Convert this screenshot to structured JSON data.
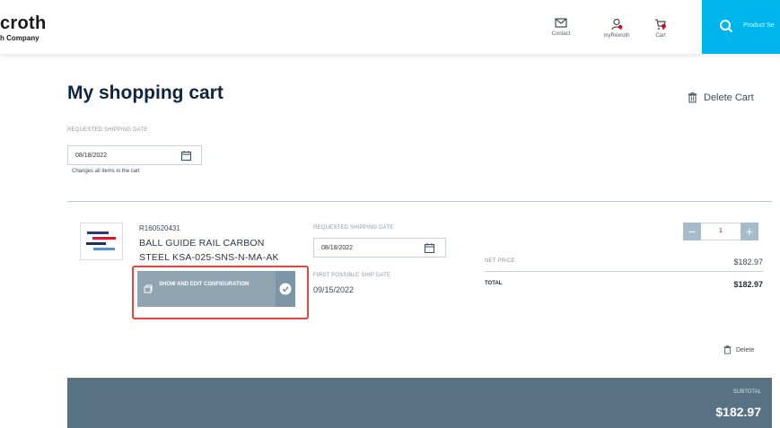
{
  "header": {
    "brand_name": "croth",
    "brand_tagline": "h Company",
    "nav": [
      {
        "label": "Contact",
        "icon": "envelope-icon"
      },
      {
        "label": "myRexroth",
        "icon": "user-icon"
      },
      {
        "label": "Cart",
        "icon": "cart-icon"
      }
    ],
    "search_label": "Product Se"
  },
  "page": {
    "title": "My shopping cart",
    "delete_cart": "Delete Cart",
    "requested_shipping_date_label": "REQUESTED SHIPPING DATE",
    "requested_shipping_date": "08/18/2022",
    "date_hint": "Changes all items in the cart"
  },
  "item": {
    "sku": "R160520431",
    "name": "BALL GUIDE RAIL CARBON STEEL KSA-025-SNS-N-MA-AK",
    "config_button": "SHOW AND EDIT CONFIGURATION",
    "requested_date_label": "REQUESTED SHIPPING DATE",
    "requested_date": "08/18/2022",
    "first_ship_label": "FIRST POSSIBLE SHIP DATE",
    "first_ship_date": "09/15/2022",
    "qty_minus": "−",
    "quantity": "1",
    "qty_plus": "+",
    "net_price_label": "NET PRICE",
    "net_price": "$182.97",
    "total_label": "TOTAL",
    "total": "$182.97",
    "delete_label": "Delete"
  },
  "summary": {
    "subtotal_label": "SUBTOTAL",
    "subtotal": "$182.97"
  },
  "colors": {
    "accent": "#00b5ee",
    "subtotal_bar": "#587183",
    "config_button": "#90a4b2",
    "highlight": "#e0473f",
    "cart_badge": "#e2001a"
  }
}
